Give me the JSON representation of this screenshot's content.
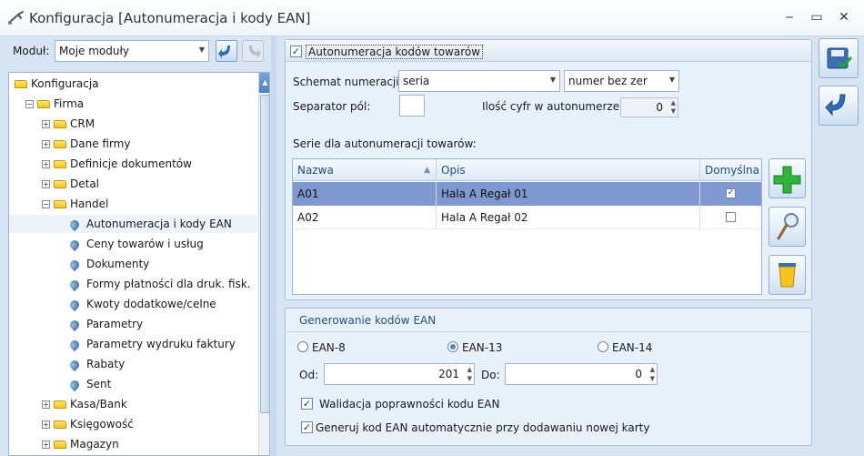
{
  "window": {
    "title": "Konfiguracja [Autonumeracja i kody EAN]",
    "minimize": "‒",
    "maximize": "▭",
    "close": "✕"
  },
  "left": {
    "modul_label": "Moduł:",
    "modul_value": "Moje moduły",
    "tree": [
      {
        "label": "Konfiguracja",
        "level": 0,
        "type": "folder",
        "expander": ""
      },
      {
        "label": "Firma",
        "level": 1,
        "type": "folder",
        "expander": "−"
      },
      {
        "label": "CRM",
        "level": 2,
        "type": "folder",
        "expander": "+"
      },
      {
        "label": "Dane firmy",
        "level": 2,
        "type": "folder",
        "expander": "+"
      },
      {
        "label": "Definicje dokumentów",
        "level": 2,
        "type": "folder",
        "expander": "+"
      },
      {
        "label": "Detal",
        "level": 2,
        "type": "folder",
        "expander": "+"
      },
      {
        "label": "Handel",
        "level": 2,
        "type": "folder",
        "expander": "−"
      },
      {
        "label": "Autonumeracja i kody EAN",
        "level": 3,
        "type": "leaf",
        "expander": "",
        "selected": true
      },
      {
        "label": "Ceny towarów i usług",
        "level": 3,
        "type": "leaf",
        "expander": ""
      },
      {
        "label": "Dokumenty",
        "level": 3,
        "type": "leaf",
        "expander": ""
      },
      {
        "label": "Formy płatności dla druk. fisk.",
        "level": 3,
        "type": "leaf",
        "expander": ""
      },
      {
        "label": "Kwoty dodatkowe/celne",
        "level": 3,
        "type": "leaf",
        "expander": ""
      },
      {
        "label": "Parametry",
        "level": 3,
        "type": "leaf",
        "expander": ""
      },
      {
        "label": "Parametry wydruku faktury",
        "level": 3,
        "type": "leaf",
        "expander": ""
      },
      {
        "label": "Rabaty",
        "level": 3,
        "type": "leaf",
        "expander": ""
      },
      {
        "label": "Sent",
        "level": 3,
        "type": "leaf",
        "expander": ""
      },
      {
        "label": "Kasa/Bank",
        "level": 2,
        "type": "folder",
        "expander": "+"
      },
      {
        "label": "Księgowość",
        "level": 2,
        "type": "folder",
        "expander": "+"
      },
      {
        "label": "Magazyn",
        "level": 2,
        "type": "folder",
        "expander": "+"
      }
    ]
  },
  "autonum": {
    "checkbox_label": "Autonumeracja kodów towarów",
    "checked": true,
    "schemat_label": "Schemat numeracji:",
    "schemat_value": "seria",
    "numer_value": "numer bez zer",
    "separator_label": "Separator pól:",
    "separator_value": "",
    "ilosc_label": "Ilość cyfr w autonumerze:",
    "ilosc_value": "0",
    "serie_label": "Serie dla autonumeracji towarów:",
    "columns": [
      "Nazwa",
      "Opis",
      "Domyślna"
    ],
    "rows": [
      {
        "nazwa": "A01",
        "opis": "Hala A Regał 01",
        "domyslna": true
      },
      {
        "nazwa": "A02",
        "opis": "Hala A Regał 02",
        "domyslna": false
      }
    ]
  },
  "ean": {
    "title": "Generowanie kodów EAN",
    "options": [
      "EAN-8",
      "EAN-13",
      "EAN-14"
    ],
    "selected": "EAN-13",
    "od_label": "Od:",
    "od_value": "201",
    "do_label": "Do:",
    "do_value": "0",
    "walidacja_label": "Walidacja poprawności kodu EAN",
    "walidacja_checked": true,
    "generuj_label": "Generuj kod EAN automatycznie przy dodawaniu nowej karty",
    "generuj_checked": true
  },
  "colors": {
    "selected_row": "#7f98cf",
    "accent": "#1f4e8c",
    "background": "#d6e4f3"
  }
}
